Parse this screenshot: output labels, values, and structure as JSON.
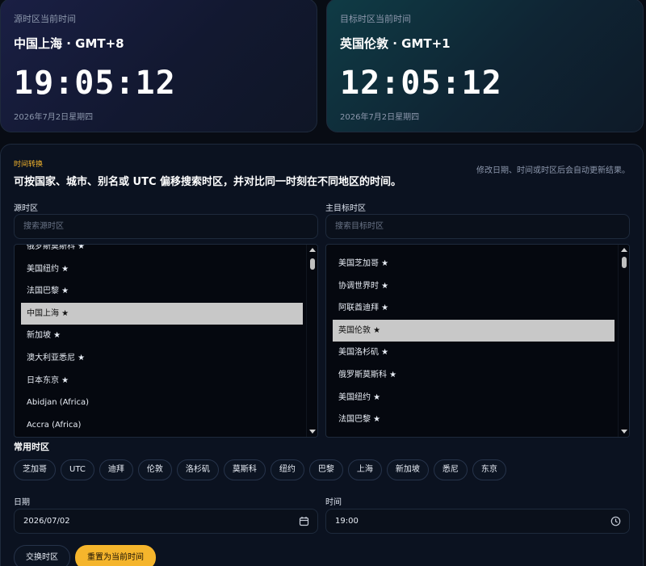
{
  "source_clock": {
    "label": "源时区当前时间",
    "zone": "中国上海 · GMT+8",
    "time": "19:05:12",
    "date": "2026年7月2日星期四"
  },
  "target_clock": {
    "label": "目标时区当前时间",
    "zone": "英国伦敦 · GMT+1",
    "time": "12:05:12",
    "date": "2026年7月2日星期四"
  },
  "converter": {
    "tag": "时间转换",
    "title": "可按国家、城市、别名或 UTC 偏移搜索时区，并对比同一时刻在不同地区的时间。",
    "hint": "修改日期、时间或时区后会自动更新结果。"
  },
  "source_panel": {
    "label": "源时区",
    "search_placeholder": "搜索源时区",
    "items": [
      {
        "label": "俄罗斯莫斯科 ★",
        "selected": false
      },
      {
        "label": "美国纽约 ★",
        "selected": false
      },
      {
        "label": "法国巴黎 ★",
        "selected": false
      },
      {
        "label": "中国上海 ★",
        "selected": true
      },
      {
        "label": "新加坡 ★",
        "selected": false
      },
      {
        "label": "澳大利亚悉尼 ★",
        "selected": false
      },
      {
        "label": "日本东京 ★",
        "selected": false
      },
      {
        "label": "Abidjan (Africa)",
        "selected": false
      },
      {
        "label": "Accra (Africa)",
        "selected": false
      }
    ]
  },
  "target_panel": {
    "label": "主目标时区",
    "search_placeholder": "搜索目标时区",
    "items": [
      {
        "label": "美国芝加哥 ★",
        "selected": false
      },
      {
        "label": "协调世界时 ★",
        "selected": false
      },
      {
        "label": "阿联酋迪拜 ★",
        "selected": false
      },
      {
        "label": "英国伦敦 ★",
        "selected": true
      },
      {
        "label": "美国洛杉矶 ★",
        "selected": false
      },
      {
        "label": "俄罗斯莫斯科 ★",
        "selected": false
      },
      {
        "label": "美国纽约 ★",
        "selected": false
      },
      {
        "label": "法国巴黎 ★",
        "selected": false
      }
    ]
  },
  "common_zones": {
    "label": "常用时区",
    "chips": [
      "芝加哥",
      "UTC",
      "迪拜",
      "伦敦",
      "洛杉矶",
      "莫斯科",
      "纽约",
      "巴黎",
      "上海",
      "新加坡",
      "悉尼",
      "东京"
    ]
  },
  "date_field": {
    "label": "日期",
    "value": "2026/07/02",
    "icon": "calendar-icon"
  },
  "time_field": {
    "label": "时间",
    "value": "19:00",
    "icon": "clock-icon"
  },
  "buttons": {
    "swap": "交换时区",
    "reset": "重置为当前时间"
  },
  "colors": {
    "accent": "#f5b52c",
    "background": "#080c14",
    "panel": "#0b1220",
    "selected_row": "#c8c8c8"
  }
}
